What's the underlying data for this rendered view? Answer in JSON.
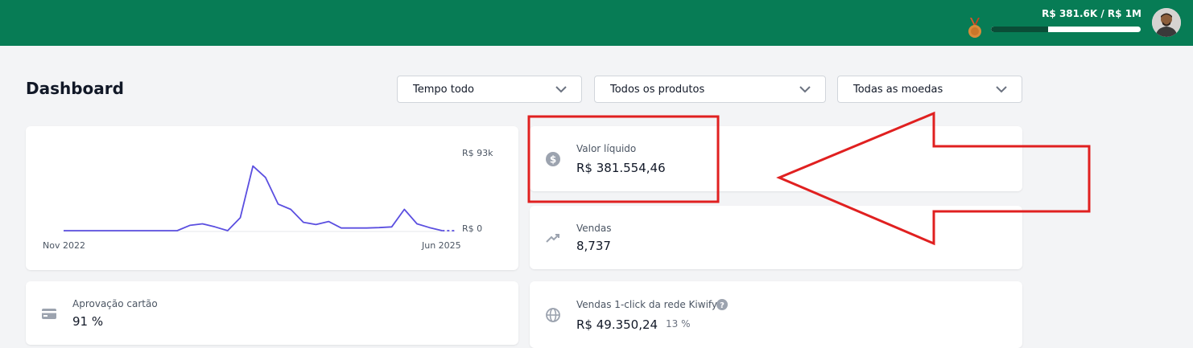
{
  "header": {
    "goal_text": "R$ 381.6K / R$ 1M",
    "goal_progress_fraction": 0.38,
    "medal_icon": "bronze-medal-icon",
    "avatar_icon": "user-avatar",
    "brand_color": "#077c55"
  },
  "page": {
    "title": "Dashboard"
  },
  "filters": {
    "period": "Tempo todo",
    "products": "Todos os produtos",
    "currencies": "Todas as moedas"
  },
  "chart_data": {
    "type": "line",
    "x_start_label": "Nov 2022",
    "x_end_label": "Jun 2025",
    "y_max_label": "R$ 93k",
    "y_min_label": "R$ 0",
    "ylim": [
      0,
      93000
    ],
    "line_color": "#5b4fe0",
    "values": [
      0,
      0,
      0,
      0,
      0,
      0,
      0,
      0,
      0,
      0,
      7000,
      9000,
      5000,
      0,
      17000,
      85000,
      70000,
      35000,
      28000,
      11000,
      8000,
      12000,
      3500,
      3500,
      3500,
      4000,
      5000,
      28000,
      9000,
      4000,
      0,
      0
    ],
    "dashed_tail_from_index": 30
  },
  "stats": {
    "net_value": {
      "label": "Valor líquido",
      "value": "R$ 381.554,46",
      "icon": "dollar-coin-icon"
    },
    "sales": {
      "label": "Vendas",
      "value": "8,737",
      "icon": "trending-up-icon"
    },
    "card_approval": {
      "label": "Aprovação cartão",
      "value": "91 %",
      "icon": "credit-card-icon"
    },
    "kiwify_network": {
      "label": "Vendas 1-click da rede Kiwify",
      "value": "R$ 49.350,24",
      "pct": "13 %",
      "icon": "globe-icon",
      "help_icon": "question-circle-icon"
    }
  },
  "annotation": {
    "highlight_color": "#e02020"
  }
}
